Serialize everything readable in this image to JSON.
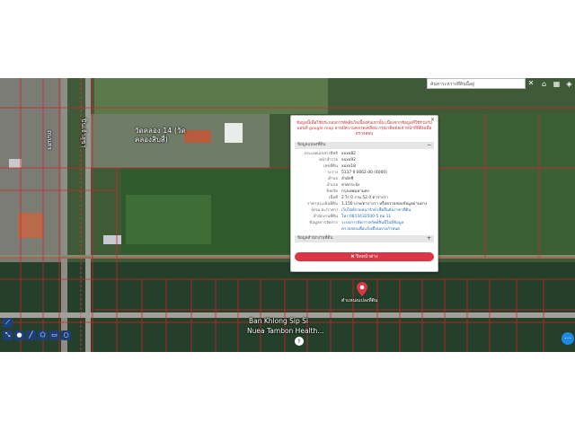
{
  "search": {
    "placeholder": "ค้นหาระหว่างที่ดินนี้อยู่"
  },
  "map_labels": {
    "temple": "วัดคลอง 14 (วัด\nคลองสิบสี่)",
    "road_upper": "ถนนสร",
    "road_lower": "ปิ่นเจ้าสุขา",
    "place_line1": "Ban Khlong Sip Si",
    "place_line2": "Nuea Tambon Health..."
  },
  "popup": {
    "notice": "ข้อมูลนี้เพื่อใช้ประกอบการตัดสินใจเบื้องต้นเท่านั้น เนื่องจากข้อมูลที่ใช้ร่วมกับแผนที่ google map อาจมีความคลาดเคลื่อน กรุณาติดต่อเจ้าหน้าที่ที่ดินเพื่อตรวจสอบ",
    "section1_title": "ข้อมูลแปลงที่ดิน",
    "section1_toggle": "−",
    "rows": [
      {
        "label": "ประเภทเอกสารสิทธิ",
        "value": "xxxx82"
      },
      {
        "label": "หน้าสำรวจ",
        "value": "xxxx92"
      },
      {
        "label": "เลขที่ดิน",
        "value": "xxxx18"
      },
      {
        "label": "ระวาง",
        "value": "5137 II 0662-00 (4000)"
      },
      {
        "label": "ตำบล",
        "value": "ลำผักชี"
      },
      {
        "label": "อำเภอ",
        "value": "ลาดกระบัง"
      },
      {
        "label": "จังหวัด",
        "value": "กรุงเทพมหานคร"
      },
      {
        "label": "เนื้อที่",
        "value": "2 ไร่ 0 งาน 52.0 ตารางวา"
      },
      {
        "label": "ราคาประเมินที่ดิน",
        "value": "1,150 บาท/ตารางวา หรือตรวจสอบข้อมูลผ่านทาง"
      },
      {
        "label": "(ตรม.ละ/ราคา)",
        "value": "เว็บไซต์กรมธนารักษ์ เพื่อยืนยันราคาที่ดิน",
        "link": true
      },
      {
        "label": "สำนักงานที่ดิน",
        "value": "โทร.0813432500-5 ต่อ 11",
        "link": true
      },
      {
        "label": "ข้อมูลการจัดการ",
        "value": "ระบบการจัดการทรัพย์สินนี้ไม่มีข้อมูล",
        "link": true
      },
      {
        "label": "",
        "value": "ตรวจสอบเพื่อแจ้งเตือนตามกำหนด",
        "link": true
      }
    ],
    "section2_title": "ข้อมูลสำนักงานที่ดิน",
    "section2_toggle": "+",
    "close_button": "✖ ปิดหน้าต่าง",
    "close_icon": "×"
  },
  "pin_label": "ตำแหน่งแปลงที่ดิน",
  "colors": {
    "accent_red": "#dc3545",
    "parcel_line": "#d0242c",
    "toolbar_blue": "#1c3f79",
    "fab_blue": "#1e88e5"
  }
}
